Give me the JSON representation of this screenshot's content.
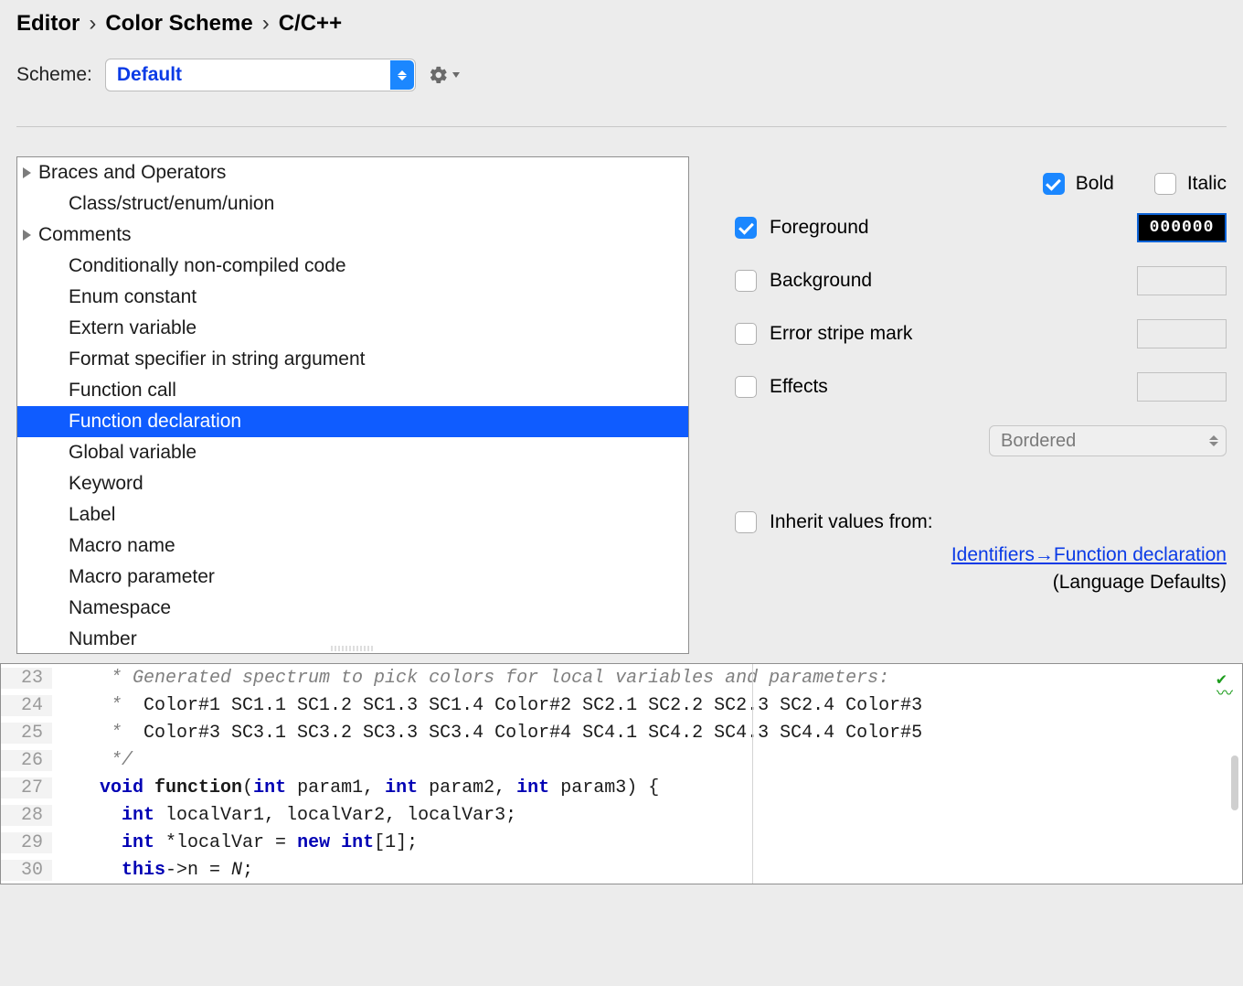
{
  "breadcrumb": {
    "a": "Editor",
    "b": "Color Scheme",
    "c": "C/C++"
  },
  "scheme": {
    "label": "Scheme:",
    "value": "Default"
  },
  "tree": {
    "items": [
      {
        "label": "Braces and Operators",
        "expandable": true
      },
      {
        "label": "Class/struct/enum/union",
        "indent": true
      },
      {
        "label": "Comments",
        "expandable": true
      },
      {
        "label": "Conditionally non-compiled code",
        "indent": true
      },
      {
        "label": "Enum constant",
        "indent": true
      },
      {
        "label": "Extern variable",
        "indent": true
      },
      {
        "label": "Format specifier in string argument",
        "indent": true
      },
      {
        "label": "Function call",
        "indent": true
      },
      {
        "label": "Function declaration",
        "indent": true,
        "selected": true
      },
      {
        "label": "Global variable",
        "indent": true
      },
      {
        "label": "Keyword",
        "indent": true
      },
      {
        "label": "Label",
        "indent": true
      },
      {
        "label": "Macro name",
        "indent": true
      },
      {
        "label": "Macro parameter",
        "indent": true
      },
      {
        "label": "Namespace",
        "indent": true
      },
      {
        "label": "Number",
        "indent": true
      }
    ]
  },
  "opts": {
    "bold": "Bold",
    "italic": "Italic",
    "foreground": "Foreground",
    "fg_value": "000000",
    "background": "Background",
    "error_stripe": "Error stripe mark",
    "effects": "Effects",
    "bordered": "Bordered",
    "inherit": "Inherit values from:",
    "inherit_link": "Identifiers→Function declaration",
    "lang_def": "(Language Defaults)"
  },
  "code": {
    "lines": [
      {
        "n": "23",
        "pre": "     * ",
        "cmt": "Generated spectrum to pick colors for local variables and parameters:"
      },
      {
        "n": "24",
        "pre": "     *  ",
        "txt": "Color#1 SC1.1 SC1.2 SC1.3 SC1.4 Color#2 SC2.1 SC2.2 SC2.3 SC2.4 Color#3"
      },
      {
        "n": "25",
        "pre": "     *  ",
        "txt": "Color#3 SC3.1 SC3.2 SC3.3 SC3.4 Color#4 SC4.1 SC4.2 SC4.3 SC4.4 Color#5"
      },
      {
        "n": "26",
        "pre": "     ",
        "cmt_plain": "*/"
      },
      {
        "n": "27",
        "fn_line": true
      },
      {
        "n": "28",
        "var_line": true
      },
      {
        "n": "29",
        "new_line": true
      },
      {
        "n": "30",
        "this_line": true
      }
    ],
    "kw_void": "void",
    "kw_int": "int",
    "kw_new": "new",
    "kw_this": "this",
    "fn_name": "function",
    "p1": "param1",
    "p2": "param2",
    "p3": "param3",
    "lv1": "localVar1",
    "lv2": "localVar2",
    "lv3": "localVar3",
    "lv": "localVar",
    "n_field": "n",
    "n_val": "N"
  }
}
